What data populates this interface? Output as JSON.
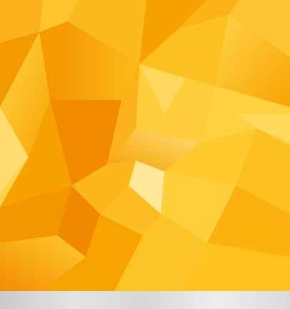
{
  "image": {
    "subject": "abstract-low-poly-orange-background",
    "palette": {
      "deep_orange": "#f08a00",
      "orange": "#f7a400",
      "amber": "#fbbf10",
      "light_amber": "#ffd24a",
      "highlight": "#ffe89a",
      "strip_gray": "#d7d7d7"
    }
  }
}
